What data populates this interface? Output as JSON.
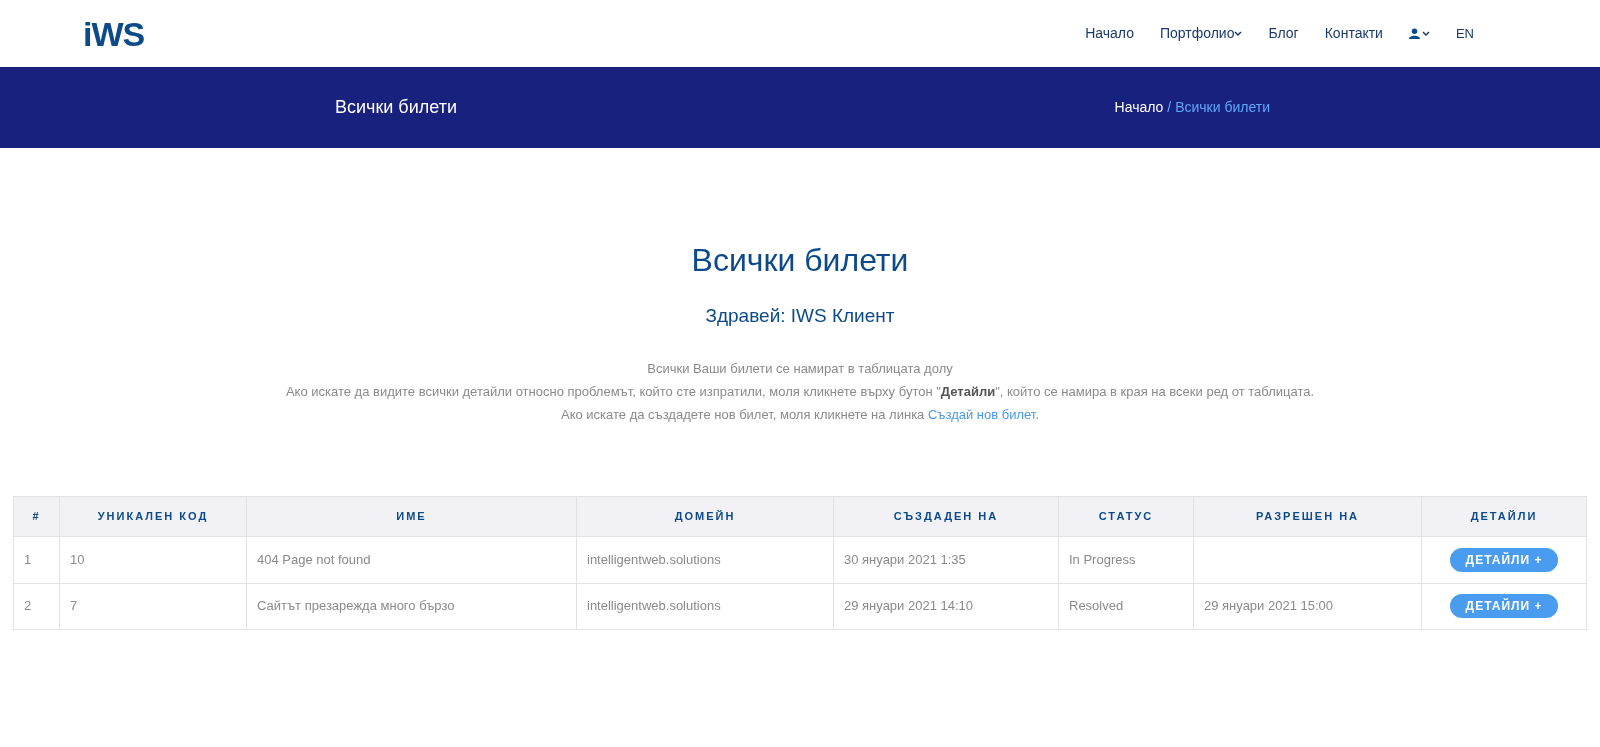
{
  "logo": "iWS",
  "nav": [
    {
      "label": "Начало",
      "dropdown": false
    },
    {
      "label": "Портфолио",
      "dropdown": true
    },
    {
      "label": "Блог",
      "dropdown": false
    },
    {
      "label": "Контакти",
      "dropdown": false
    }
  ],
  "language": "EN",
  "banner": {
    "title": "Всички билети",
    "breadcrumb": [
      {
        "label": "Начало",
        "current": false
      },
      {
        "label": "/ Всички билети",
        "current": true
      }
    ]
  },
  "heading": "Всички билети",
  "greeting": "Здравей: IWS Клиент",
  "intro": {
    "lines": [
      "Всички Ваши билети се намират в таблицата долу",
      "Ако искате да видите всички детайли относно проблемът, който сте изпратили, моля кликнете върху бутон \"**Детайли**\", който се намира в края на всеки ред от таблицата."
    ],
    "last_before": "Ако искате да създадете нов билет, моля кликнете на линка",
    "last_link": "Създай нов билет",
    "last_after": "."
  },
  "table": {
    "columns": [
      "#",
      "УНИКАЛЕН КОД",
      "ИМЕ",
      "ДОМЕЙН",
      "СЪЗДАДЕН НА",
      "СТАТУС",
      "РАЗРЕШЕН НА",
      "ДЕТАЙЛИ"
    ],
    "rows": [
      {
        "cells": [
          "1",
          "10",
          "404 Page not found",
          "intelligentweb.solutions",
          "30 януари 2021 1:35",
          "In Progress",
          ""
        ],
        "button": "ДЕТАЙЛИ +"
      },
      {
        "cells": [
          "2",
          "7",
          "Сайтът презарежда много бързо",
          "intelligentweb.solutions",
          "29 януари 2021 14:10",
          "Resolved",
          "29 януари 2021 15:00"
        ],
        "button": "ДЕТАЙЛИ +"
      }
    ]
  }
}
